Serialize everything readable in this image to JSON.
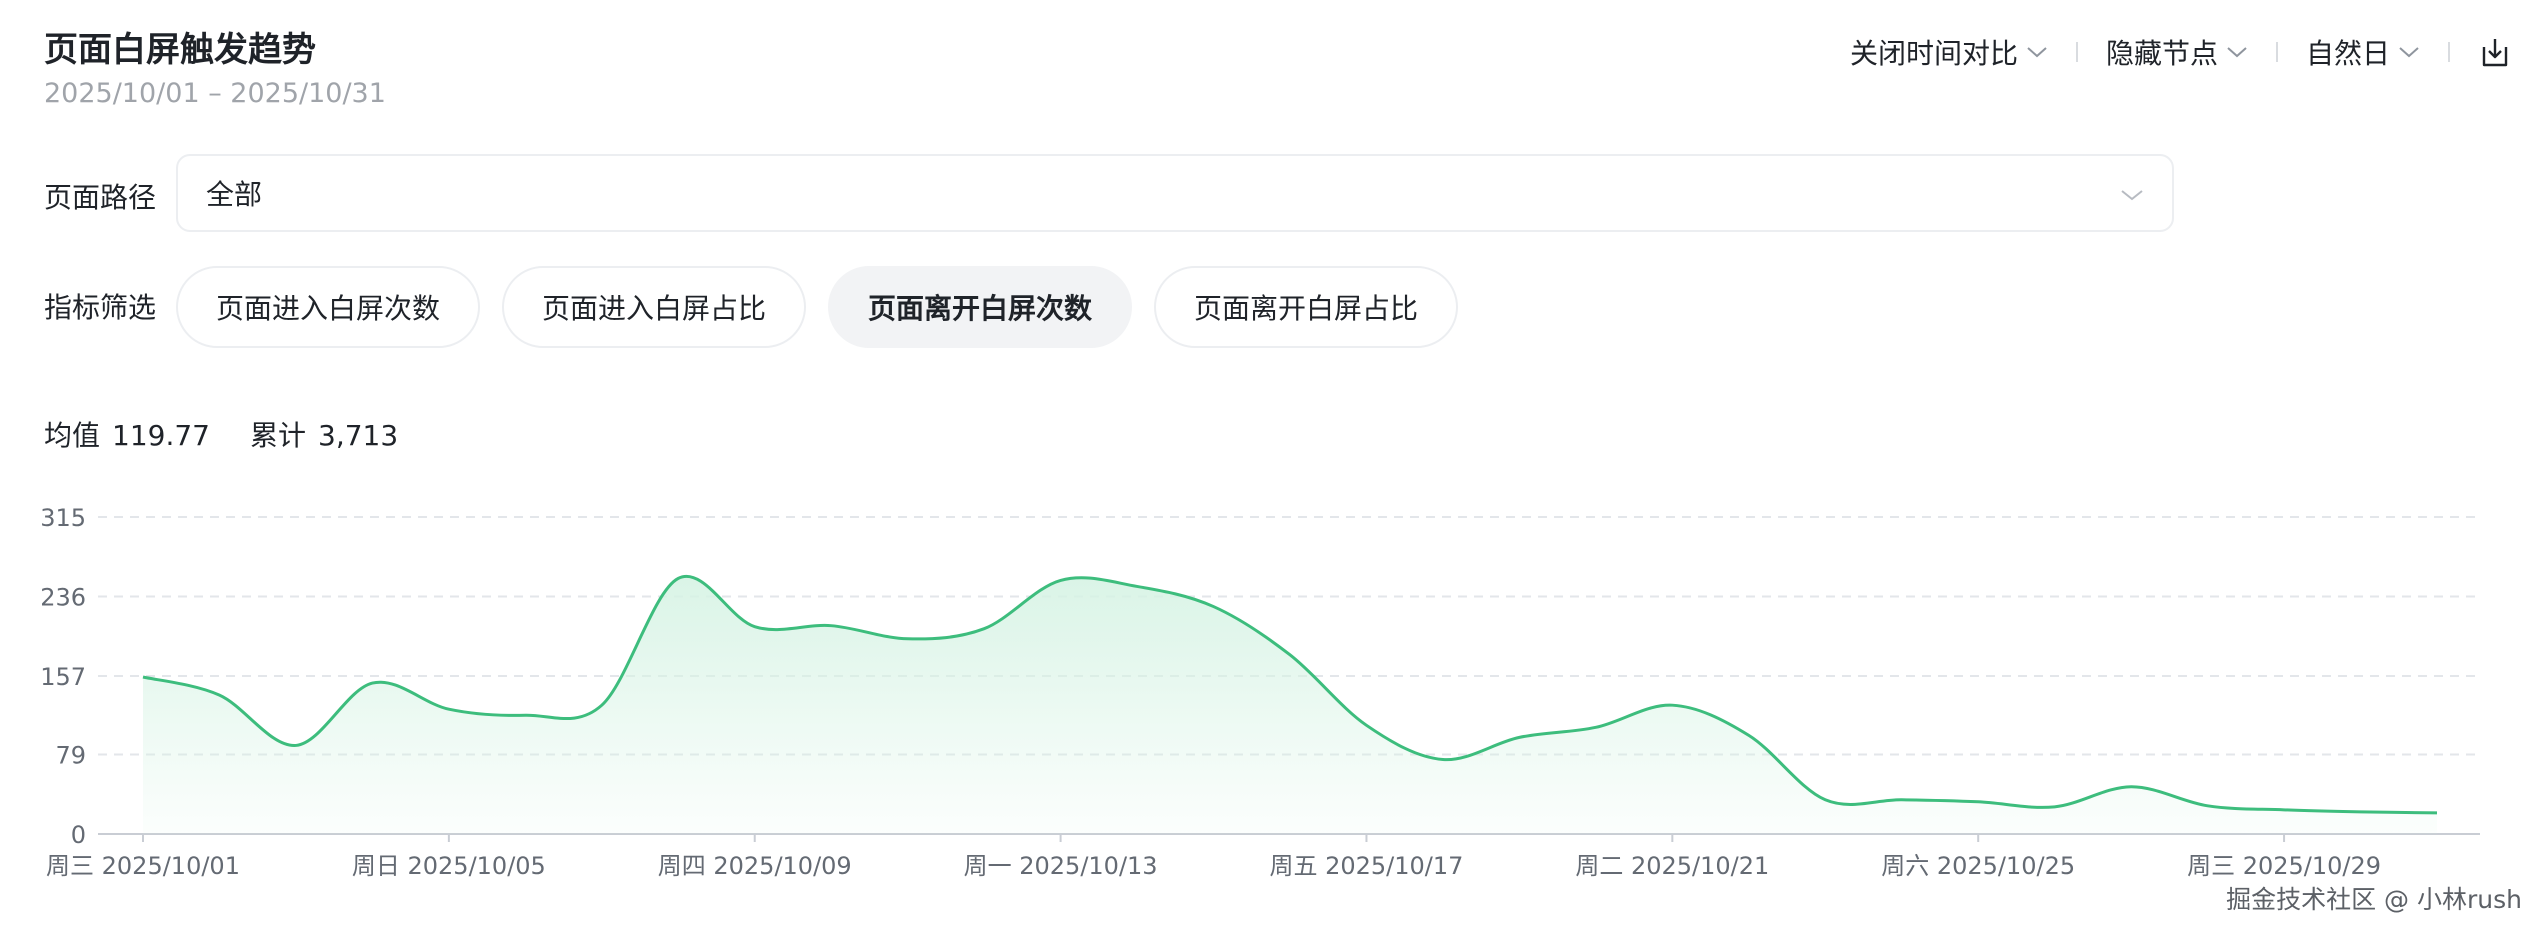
{
  "header": {
    "title": "页面白屏触发趋势",
    "date_range": "2025/10/01 – 2025/10/31"
  },
  "toolbar": {
    "compare_label": "关闭时间对比",
    "hide_nodes_label": "隐藏节点",
    "granularity_label": "自然日",
    "export_icon": "export-icon"
  },
  "filters": {
    "path_label": "页面路径",
    "path_value": "全部",
    "metric_label": "指标筛选",
    "metrics": [
      {
        "label": "页面进入白屏次数",
        "active": false
      },
      {
        "label": "页面进入白屏占比",
        "active": false
      },
      {
        "label": "页面离开白屏次数",
        "active": true
      },
      {
        "label": "页面离开白屏占比",
        "active": false
      }
    ]
  },
  "summary": {
    "avg_label": "均值",
    "avg_value": "119.77",
    "total_label": "累计",
    "total_value": "3,713"
  },
  "colors": {
    "line": "#3dbd7d",
    "area_top": "#d6f3e4",
    "grid": "#e3e6ea",
    "axis_text": "#646a73"
  },
  "chart_data": {
    "type": "area",
    "y_ticks": [
      0,
      79,
      157,
      236,
      315
    ],
    "ylim": [
      0,
      315
    ],
    "x_tick_labels": [
      "周三 2025/10/01",
      "周日 2025/10/05",
      "周四 2025/10/09",
      "周一 2025/10/13",
      "周五 2025/10/17",
      "周二 2025/10/21",
      "周六 2025/10/25",
      "周三 2025/10/29"
    ],
    "x": [
      "2025/10/01",
      "2025/10/02",
      "2025/10/03",
      "2025/10/04",
      "2025/10/05",
      "2025/10/06",
      "2025/10/07",
      "2025/10/08",
      "2025/10/09",
      "2025/10/10",
      "2025/10/11",
      "2025/10/12",
      "2025/10/13",
      "2025/10/14",
      "2025/10/15",
      "2025/10/16",
      "2025/10/17",
      "2025/10/18",
      "2025/10/19",
      "2025/10/20",
      "2025/10/21",
      "2025/10/22",
      "2025/10/23",
      "2025/10/24",
      "2025/10/25",
      "2025/10/26",
      "2025/10/27",
      "2025/10/28",
      "2025/10/29",
      "2025/10/30",
      "2025/10/31"
    ],
    "values": [
      156,
      138,
      88,
      150,
      124,
      118,
      128,
      254,
      206,
      207,
      194,
      204,
      252,
      246,
      226,
      178,
      108,
      74,
      96,
      106,
      128,
      98,
      34,
      34,
      32,
      27,
      47,
      28,
      24,
      22,
      21
    ],
    "grid": true
  },
  "watermark": "掘金技术社区 @ 小林rush"
}
